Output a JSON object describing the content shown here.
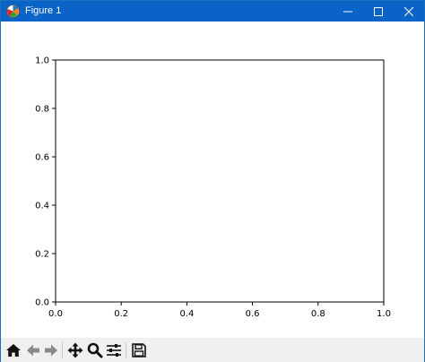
{
  "window": {
    "title": "Figure 1",
    "icons": {
      "app": "matplotlib-icon",
      "minimize": "minimize-icon",
      "maximize": "maximize-icon",
      "close": "close-icon"
    },
    "titlebar_color": "#0a64c8"
  },
  "toolbar": {
    "tools": [
      {
        "name": "home-icon"
      },
      {
        "name": "back-arrow-icon"
      },
      {
        "name": "forward-arrow-icon"
      },
      {
        "name": "pan-move-icon"
      },
      {
        "name": "zoom-magnifier-icon"
      },
      {
        "name": "configure-subplots-icon"
      },
      {
        "name": "save-disk-icon"
      }
    ]
  },
  "chart_data": {
    "type": "line",
    "series": [],
    "xlim": [
      0.0,
      1.0
    ],
    "ylim": [
      0.0,
      1.0
    ],
    "xticks": [
      0.0,
      0.2,
      0.4,
      0.6,
      0.8,
      1.0
    ],
    "yticks": [
      0.0,
      0.2,
      0.4,
      0.6,
      0.8,
      1.0
    ],
    "xtick_labels": [
      "0.0",
      "0.2",
      "0.4",
      "0.6",
      "0.8",
      "1.0"
    ],
    "ytick_labels": [
      "0.0",
      "0.2",
      "0.4",
      "0.6",
      "0.8",
      "1.0"
    ],
    "grid": false
  }
}
